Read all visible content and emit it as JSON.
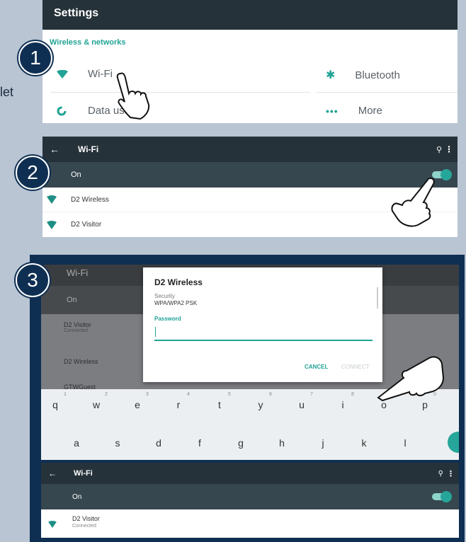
{
  "edge_text": "let",
  "badges": [
    "1",
    "2",
    "3"
  ],
  "panel1": {
    "title": "Settings",
    "section": "Wireless & networks",
    "items": [
      {
        "label": "Wi-Fi",
        "icon": "wifi-icon"
      },
      {
        "label": "Bluetooth",
        "icon": "bluetooth-icon"
      },
      {
        "label": "Data usag",
        "icon": "data-usage-icon"
      },
      {
        "label": "More",
        "icon": "more-icon"
      }
    ]
  },
  "panel2": {
    "title": "Wi-Fi",
    "on_label": "On",
    "networks": [
      {
        "name": "D2 Wireless"
      },
      {
        "name": "D2 Visitor"
      }
    ]
  },
  "panel3": {
    "bg_title": "Wi-Fi",
    "bg_on": "On",
    "bg_networks": [
      {
        "name": "D2 Visitor",
        "status": "Connected"
      },
      {
        "name": "D2 Wireless",
        "status": ""
      },
      {
        "name": "GTWGuest",
        "status": ""
      }
    ],
    "dialog": {
      "title": "D2 Wireless",
      "security_label": "Security",
      "security_value": "WPA/WPA2 PSK",
      "password_label": "Password",
      "cancel": "CANCEL",
      "connect": "CONNECT"
    },
    "keyboard": {
      "row1": [
        "q",
        "w",
        "e",
        "r",
        "t",
        "y",
        "u",
        "i",
        "o",
        "p"
      ],
      "nums": [
        "1",
        "2",
        "3",
        "4",
        "5",
        "6",
        "7",
        "8",
        "9",
        "0"
      ],
      "row2": [
        "a",
        "s",
        "d",
        "f",
        "g",
        "h",
        "j",
        "k",
        "l"
      ]
    },
    "result": {
      "title": "Wi-Fi",
      "on_label": "On",
      "network": "D2 Visitor",
      "status": "Connected"
    }
  },
  "colors": {
    "background": "#b9c5d3",
    "navy": "#0f2f52",
    "toolbar": "#26323a",
    "accent": "#21a395"
  }
}
